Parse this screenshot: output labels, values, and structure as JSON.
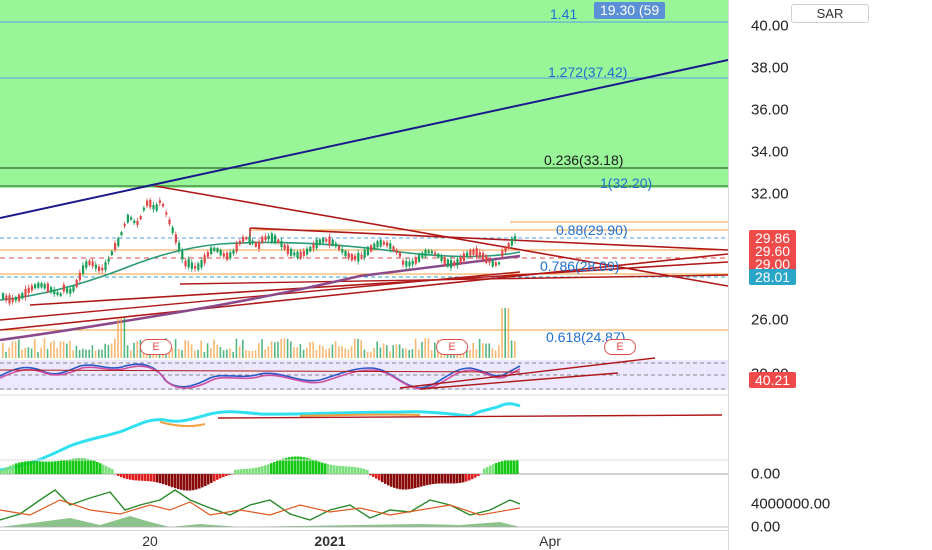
{
  "symbol_button": "SAR",
  "fib_top_tag": "19.30 (59",
  "price_axis": {
    "ticks": [
      "40.00",
      "38.00",
      "36.00",
      "34.00",
      "32.00",
      "26.00",
      "0.00",
      "4000000.00",
      "0.00"
    ],
    "partial_tick": "30.00"
  },
  "price_tags": [
    {
      "label": "29.86",
      "color": "#ef4a4a"
    },
    {
      "label": "29.60",
      "color": "#ef4a4a"
    },
    {
      "label": "29.00",
      "color": "#ef4a4a"
    },
    {
      "label": "28.01",
      "color": "#2aa6c9"
    },
    {
      "label": "40.21",
      "color": "#ef4a4a"
    }
  ],
  "fib_levels": {
    "level_1414": "1.41",
    "level_1272": "1.272(37.42)",
    "level_0236": "0.236(33.18)",
    "level_1": "1(32.20)",
    "level_088": "0.88(29.90)",
    "level_0786": "0.786(28.09)",
    "level_0618": "0.618(24.87)"
  },
  "earnings_markers": [
    "E",
    "E",
    "E"
  ],
  "time_axis": {
    "labels": [
      "20",
      "2021",
      "Apr"
    ]
  },
  "colors": {
    "green_zone": "#98f598",
    "fib_line": "#5aa0e6",
    "trend_red": "#b01818",
    "trend_navy": "#1a1a8a",
    "orange": "#f5a040",
    "candle_green": "#18a058",
    "candle_red": "#e04848"
  }
}
